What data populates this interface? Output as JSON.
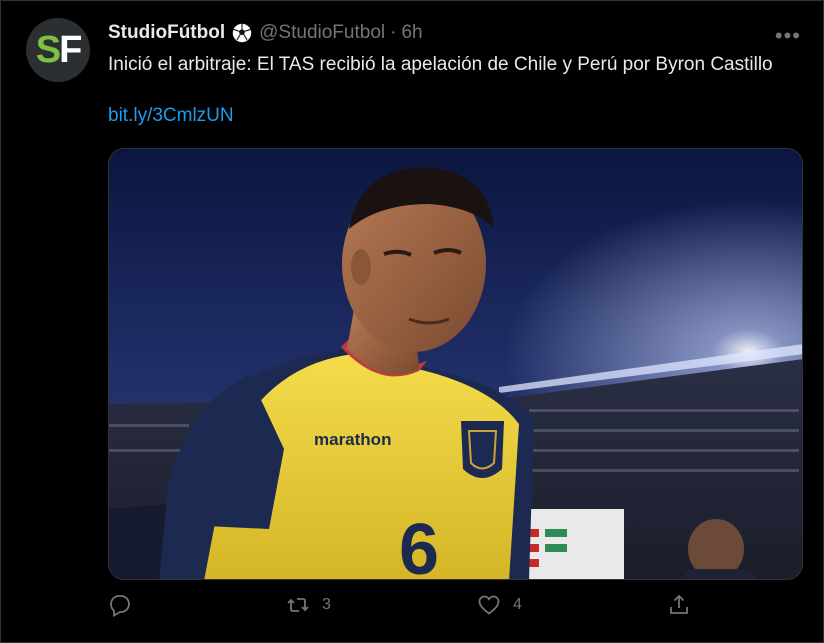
{
  "tweet": {
    "author_name": "StudioFútbol",
    "handle": "@StudioFutbol",
    "separator": "·",
    "time": "6h",
    "avatar_text_1": "S",
    "avatar_text_2": "F",
    "more_label": "•••",
    "text": "Inició el arbitraje: El TAS recibió la apelación de Chile y Perú por Byron Castillo",
    "link": "bit.ly/3CmlzUN",
    "media": {
      "jersey_brand": "marathon",
      "jersey_number": "6"
    }
  },
  "actions": {
    "reply_icon": "reply-icon",
    "retweet_icon": "retweet-icon",
    "retweet_count": "3",
    "like_icon": "heart-icon",
    "like_count": "4",
    "share_icon": "share-icon"
  },
  "colors": {
    "background": "#000000",
    "text": "#e7e9ea",
    "muted": "#71767b",
    "link": "#1d9bf0",
    "avatar_green": "#7cc242",
    "jersey_yellow": "#f0d43a",
    "jersey_blue": "#1c2a52"
  }
}
